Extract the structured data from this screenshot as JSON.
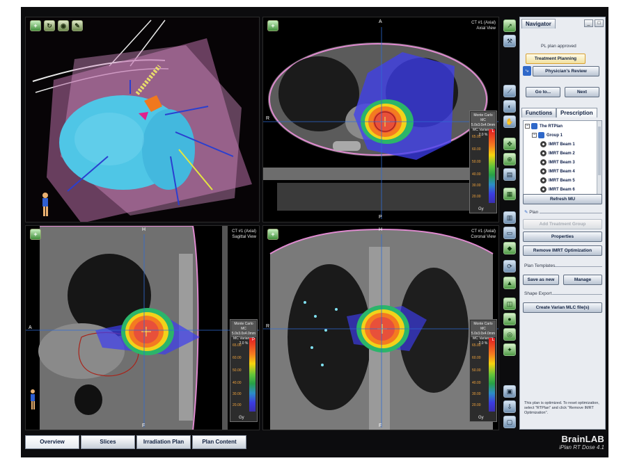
{
  "viewports": {
    "axial": {
      "title1": "CT #1 (Axial)",
      "title2": "Axial View",
      "top": "A",
      "bottom": "P",
      "left": "R",
      "right": "L"
    },
    "sagittal": {
      "title1": "CT #1 (Axial)",
      "title2": "Sagittal View",
      "top": "H",
      "bottom": "F",
      "left": "A",
      "right": "P"
    },
    "coronal": {
      "title1": "CT #1 (Axial)",
      "title2": "Coronal View",
      "top": "H",
      "bottom": "F",
      "left": "R",
      "right": "L"
    }
  },
  "legend": {
    "header": [
      "Monte Carlo",
      "MC 5.0x3.0x4.0mm",
      "MC Variance: 2.0 %"
    ],
    "unit": "Gy",
    "ticks": [
      "65.00",
      "60.00",
      "50.00",
      "40.00",
      "30.00",
      "20.00"
    ]
  },
  "navigator": {
    "title": "Navigator",
    "status": "PL plan approved",
    "steps": [
      "Treatment Planning",
      "Physician's Review"
    ],
    "goto_label": "Go to...",
    "next_label": "Next"
  },
  "function_tabs": [
    "Functions",
    "Prescription"
  ],
  "tree": {
    "root": "The RTPlan",
    "group": "Group 1",
    "beams": [
      "IMRT Beam 1",
      "IMRT Beam 2",
      "IMRT Beam 3",
      "IMRT Beam 4",
      "IMRT Beam 5",
      "IMRT Beam 6"
    ]
  },
  "panel": {
    "refresh_mu": "Refresh MU",
    "plan_section": "Plan",
    "add_group": "Add Treatment Group",
    "properties": "Properties",
    "remove_imrt": "Remove IMRT Optimization",
    "templates_section": "Plan Templates",
    "save_as_new": "Save as new",
    "manage": "Manage",
    "shape_export": "Shape Export",
    "create_mlc": "Create Varian MLC file(s)",
    "note": "This plan is optimized. To reset optimization, select \"RTPlan\" and click \"Remove IMRT Optimization\"."
  },
  "bottom_tabs": [
    "Overview",
    "Slices",
    "Irradiation Plan",
    "Plan Content"
  ],
  "brand": {
    "name": "BrainLAB",
    "product": "iPlan RT Dose 4.1"
  }
}
